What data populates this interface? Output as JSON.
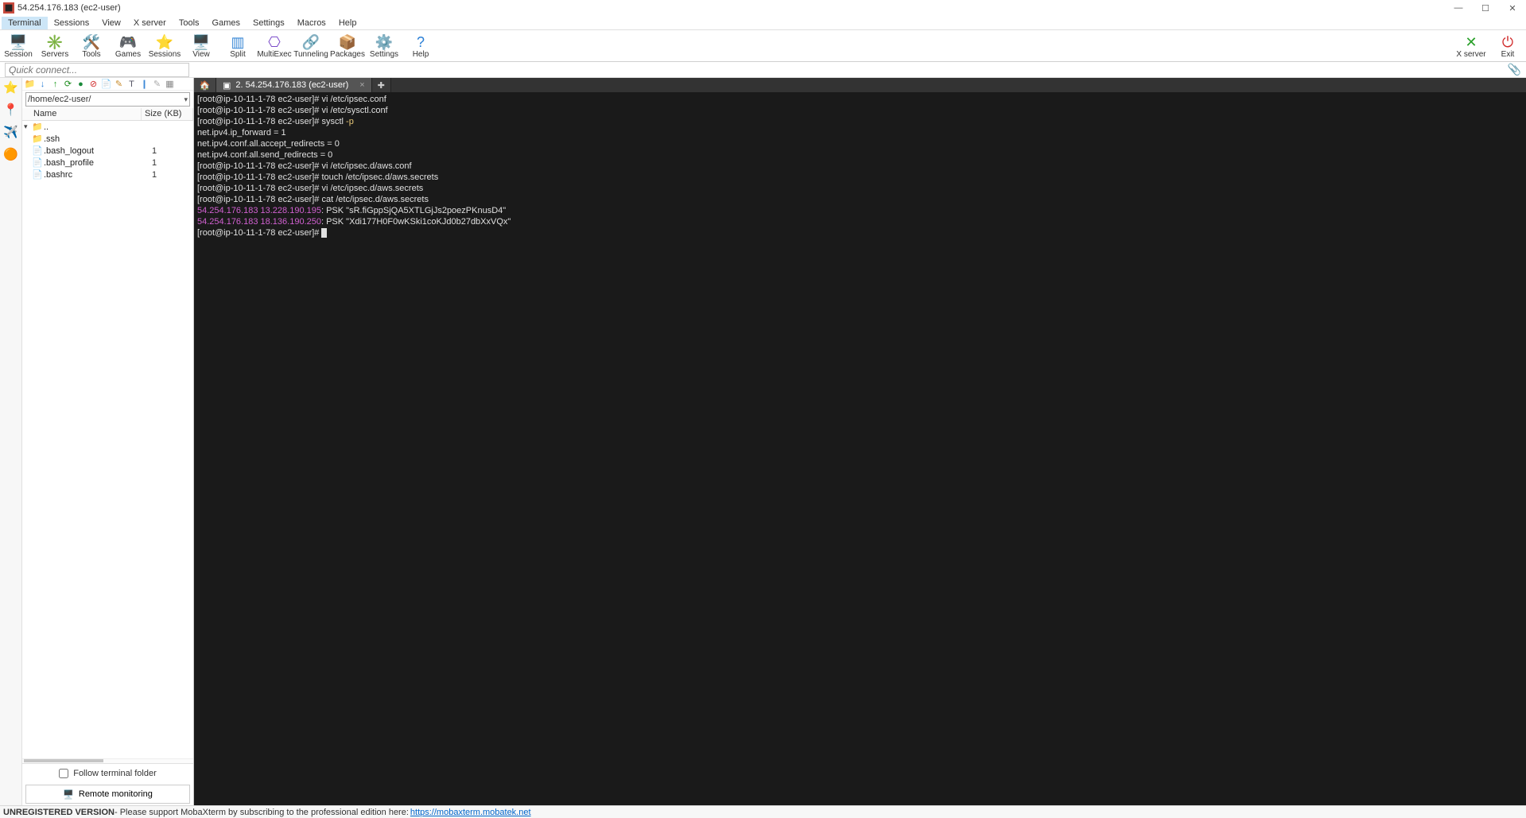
{
  "window": {
    "title": "54.254.176.183 (ec2-user)"
  },
  "menu": [
    "Terminal",
    "Sessions",
    "View",
    "X server",
    "Tools",
    "Games",
    "Settings",
    "Macros",
    "Help"
  ],
  "menu_active": 0,
  "toolbar": [
    {
      "label": "Session",
      "icon": "🖥️",
      "color": "#2d6fbf"
    },
    {
      "label": "Servers",
      "icon": "✳️",
      "color": "#3a88d6"
    },
    {
      "label": "Tools",
      "icon": "🛠️",
      "color": "#c94b3e"
    },
    {
      "label": "Games",
      "icon": "🎮",
      "color": "#d49c2a"
    },
    {
      "label": "Sessions",
      "icon": "⭐",
      "color": "#e8b923"
    },
    {
      "label": "View",
      "icon": "🖥️",
      "color": "#556"
    },
    {
      "label": "Split",
      "icon": "▥",
      "color": "#3a88d6"
    },
    {
      "label": "MultiExec",
      "icon": "⎔",
      "color": "#7b4bc9"
    },
    {
      "label": "Tunneling",
      "icon": "🔗",
      "color": "#556"
    },
    {
      "label": "Packages",
      "icon": "📦",
      "color": "#8a6d3b"
    },
    {
      "label": "Settings",
      "icon": "⚙️",
      "color": "#3a88d6"
    },
    {
      "label": "Help",
      "icon": "?",
      "color": "#2a7fd6"
    }
  ],
  "toolbar_right": [
    {
      "label": "X server",
      "icon": "✕",
      "color": "#2aa02a"
    },
    {
      "label": "Exit",
      "icon": "⏻",
      "color": "#d12b2b"
    }
  ],
  "quick_placeholder": "Quick connect...",
  "leftbar_icons": [
    "⭐",
    "📍",
    "✈️",
    "🟠"
  ],
  "sidebar": {
    "tools": [
      {
        "g": "📁",
        "c": "#d6a12a"
      },
      {
        "g": "↓",
        "c": "#2a7fd6"
      },
      {
        "g": "↑",
        "c": "#2aa02a"
      },
      {
        "g": "⟳",
        "c": "#1a8a1a"
      },
      {
        "g": "●",
        "c": "#1a8a3a"
      },
      {
        "g": "⊘",
        "c": "#d12b2b"
      },
      {
        "g": "📄",
        "c": "#88a"
      },
      {
        "g": "✎",
        "c": "#c78a2a"
      },
      {
        "g": "T",
        "c": "#556"
      },
      {
        "g": "❙",
        "c": "#3a88d6"
      },
      {
        "g": "✎",
        "c": "#aaa"
      },
      {
        "g": "▦",
        "c": "#888"
      }
    ],
    "path": "/home/ec2-user/",
    "cols": {
      "name": "Name",
      "size": "Size (KB)"
    },
    "rows": [
      {
        "icon": "📁",
        "name": "..",
        "size": ""
      },
      {
        "icon": "📁",
        "name": ".ssh",
        "size": ""
      },
      {
        "icon": "📄",
        "name": ".bash_logout",
        "size": "1"
      },
      {
        "icon": "📄",
        "name": ".bash_profile",
        "size": "1"
      },
      {
        "icon": "📄",
        "name": ".bashrc",
        "size": "1"
      }
    ],
    "follow_label": "Follow terminal folder",
    "remote_label": "Remote monitoring"
  },
  "tabs": {
    "active_label": "2. 54.254.176.183 (ec2-user)"
  },
  "terminal_lines": [
    {
      "parts": [
        {
          "t": "[root@ip-10-11-1-78 ec2-user]# ",
          "c": "prompt"
        },
        {
          "t": "vi /etc/ipsec.conf",
          "c": ""
        }
      ]
    },
    {
      "parts": [
        {
          "t": "[root@ip-10-11-1-78 ec2-user]# ",
          "c": "prompt"
        },
        {
          "t": "vi /etc/sysctl.conf",
          "c": ""
        }
      ]
    },
    {
      "parts": [
        {
          "t": "[root@ip-10-11-1-78 ec2-user]# ",
          "c": "prompt"
        },
        {
          "t": "sysctl ",
          "c": ""
        },
        {
          "t": "-p",
          "c": "yellow"
        }
      ]
    },
    {
      "parts": [
        {
          "t": "net.ipv4.ip_forward = 1",
          "c": ""
        }
      ]
    },
    {
      "parts": [
        {
          "t": "net.ipv4.conf.all.accept_redirects = 0",
          "c": ""
        }
      ]
    },
    {
      "parts": [
        {
          "t": "net.ipv4.conf.all.send_redirects = 0",
          "c": ""
        }
      ]
    },
    {
      "parts": [
        {
          "t": "[root@ip-10-11-1-78 ec2-user]# ",
          "c": "prompt"
        },
        {
          "t": "vi /etc/ipsec.d/aws.conf",
          "c": ""
        }
      ]
    },
    {
      "parts": [
        {
          "t": "[root@ip-10-11-1-78 ec2-user]# ",
          "c": "prompt"
        },
        {
          "t": "touch /etc/ipsec.d/aws.secrets",
          "c": ""
        }
      ]
    },
    {
      "parts": [
        {
          "t": "[root@ip-10-11-1-78 ec2-user]# ",
          "c": "prompt"
        },
        {
          "t": "vi /etc/ipsec.d/aws.secrets",
          "c": ""
        }
      ]
    },
    {
      "parts": [
        {
          "t": "[root@ip-10-11-1-78 ec2-user]# ",
          "c": "prompt"
        },
        {
          "t": "cat /etc/ipsec.d/aws.secrets",
          "c": ""
        }
      ]
    },
    {
      "parts": [
        {
          "t": "54.254.176.183 13.228.190.195",
          "c": "magenta"
        },
        {
          "t": ": PSK \"sR.fiGppSjQA5XTLGjJs2poezPKnusD4\"",
          "c": ""
        }
      ]
    },
    {
      "parts": [
        {
          "t": "54.254.176.183 18.136.190.250",
          "c": "magenta"
        },
        {
          "t": ": PSK \"Xdi177H0F0wKSki1coKJd0b27dbXxVQx\"",
          "c": ""
        }
      ]
    },
    {
      "parts": [
        {
          "t": "[root@ip-10-11-1-78 ec2-user]# ",
          "c": "prompt"
        }
      ],
      "cursor": true
    }
  ],
  "status": {
    "bold": "UNREGISTERED VERSION",
    "text": " - Please support MobaXterm by subscribing to the professional edition here: ",
    "link": "https://mobaxterm.mobatek.net"
  }
}
